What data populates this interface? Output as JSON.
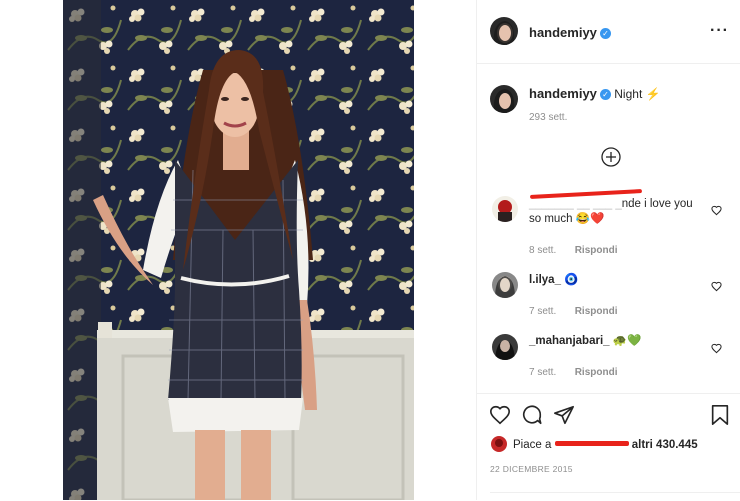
{
  "post": {
    "username": "handemiyy",
    "caption_text": "Night",
    "caption_emoji": "⚡",
    "caption_age": "293 sett.",
    "likes_prefix": "Piace a",
    "likes_suffix": "altri 430.445",
    "date": "22 DICEMBRE 2015"
  },
  "comments": [
    {
      "username": "",
      "text": "nde i love you so much",
      "emoji": "😂❤️",
      "age": "8 sett.",
      "reply": "Rispondi"
    },
    {
      "username": "l.ilya_",
      "text": "",
      "emoji": "🧿",
      "age": "7 sett.",
      "reply": "Rispondi"
    },
    {
      "username": "_mahanjabari_",
      "text": "",
      "emoji": "🐢💚",
      "age": "7 sett.",
      "reply": "Rispondi"
    }
  ],
  "icons": {
    "more": "more-options-icon",
    "load_more": "plus-circle-icon",
    "like": "heart-icon",
    "comment": "comment-icon",
    "share": "share-icon",
    "save": "bookmark-icon"
  },
  "colors": {
    "verified": "#3897f0",
    "redaction": "#e8231b",
    "text": "#262626",
    "muted": "#8e8e8e"
  }
}
